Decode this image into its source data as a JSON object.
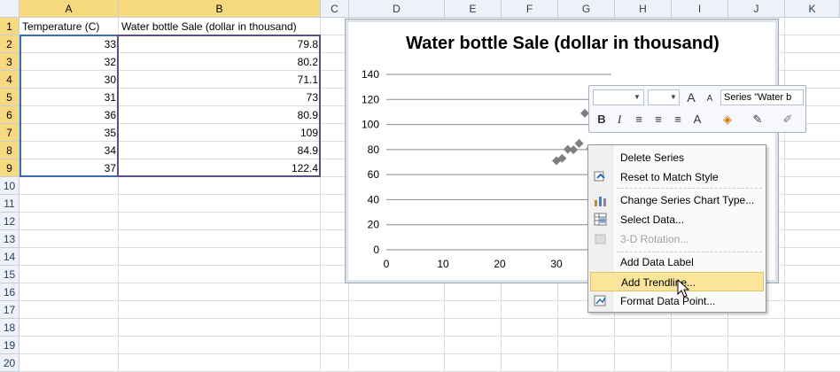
{
  "columns": [
    "A",
    "B",
    "C",
    "D",
    "E",
    "F",
    "G",
    "H",
    "I",
    "J",
    "K"
  ],
  "rows": [
    "1",
    "2",
    "3",
    "4",
    "5",
    "6",
    "7",
    "8",
    "9",
    "10",
    "11",
    "12",
    "13",
    "14",
    "15",
    "16",
    "17",
    "18",
    "19",
    "20"
  ],
  "table": {
    "header": [
      "Temperature (C)",
      "Water bottle Sale (dollar in thousand)"
    ],
    "data": [
      [
        "33",
        "79.8"
      ],
      [
        "32",
        "80.2"
      ],
      [
        "30",
        "71.1"
      ],
      [
        "31",
        "73"
      ],
      [
        "36",
        "80.9"
      ],
      [
        "35",
        "109"
      ],
      [
        "34",
        "84.9"
      ],
      [
        "37",
        "122.4"
      ]
    ]
  },
  "chart_data": {
    "type": "scatter",
    "title": "Water bottle Sale (dollar in thousand)",
    "xlim": [
      0,
      40
    ],
    "ylim": [
      0,
      140
    ],
    "x_ticks": [
      "0",
      "10",
      "20",
      "30"
    ],
    "y_ticks": [
      "0",
      "20",
      "40",
      "60",
      "80",
      "100",
      "120",
      "140"
    ],
    "grid": true,
    "series": [
      {
        "points": [
          [
            33,
            79.8
          ],
          [
            32,
            80.2
          ],
          [
            30,
            71.1
          ],
          [
            31,
            73
          ],
          [
            36,
            80.9
          ],
          [
            35,
            109
          ],
          [
            34,
            84.9
          ],
          [
            37,
            122.4
          ]
        ],
        "color": "#7f7f7f"
      }
    ]
  },
  "mini_toolbar": {
    "series_combo": "Series \"Water b",
    "grow_font": "A",
    "shrink_font": "A",
    "bold": "B",
    "italic": "I",
    "font_color": "A"
  },
  "context_menu": {
    "items": [
      {
        "label": "Delete Series",
        "icon": "",
        "disabled": false
      },
      {
        "label": "Reset to Match Style",
        "icon": "reset-style-icon",
        "disabled": false
      },
      {
        "label": "Change Series Chart Type...",
        "icon": "chart-type-icon",
        "disabled": false
      },
      {
        "label": "Select Data...",
        "icon": "select-data-icon",
        "disabled": false
      },
      {
        "label": "3-D Rotation...",
        "icon": "rotation-icon",
        "disabled": true
      },
      {
        "label": "Add Data Label",
        "icon": "",
        "disabled": false
      },
      {
        "label": "Add Trendline...",
        "icon": "",
        "disabled": false,
        "hover": true
      },
      {
        "label": "Format Data Point...",
        "icon": "format-icon",
        "disabled": false
      }
    ]
  },
  "colors": {
    "selection": "#f7d980",
    "marker": "#7f7f7f",
    "menu_hover": "#fbe59a"
  }
}
